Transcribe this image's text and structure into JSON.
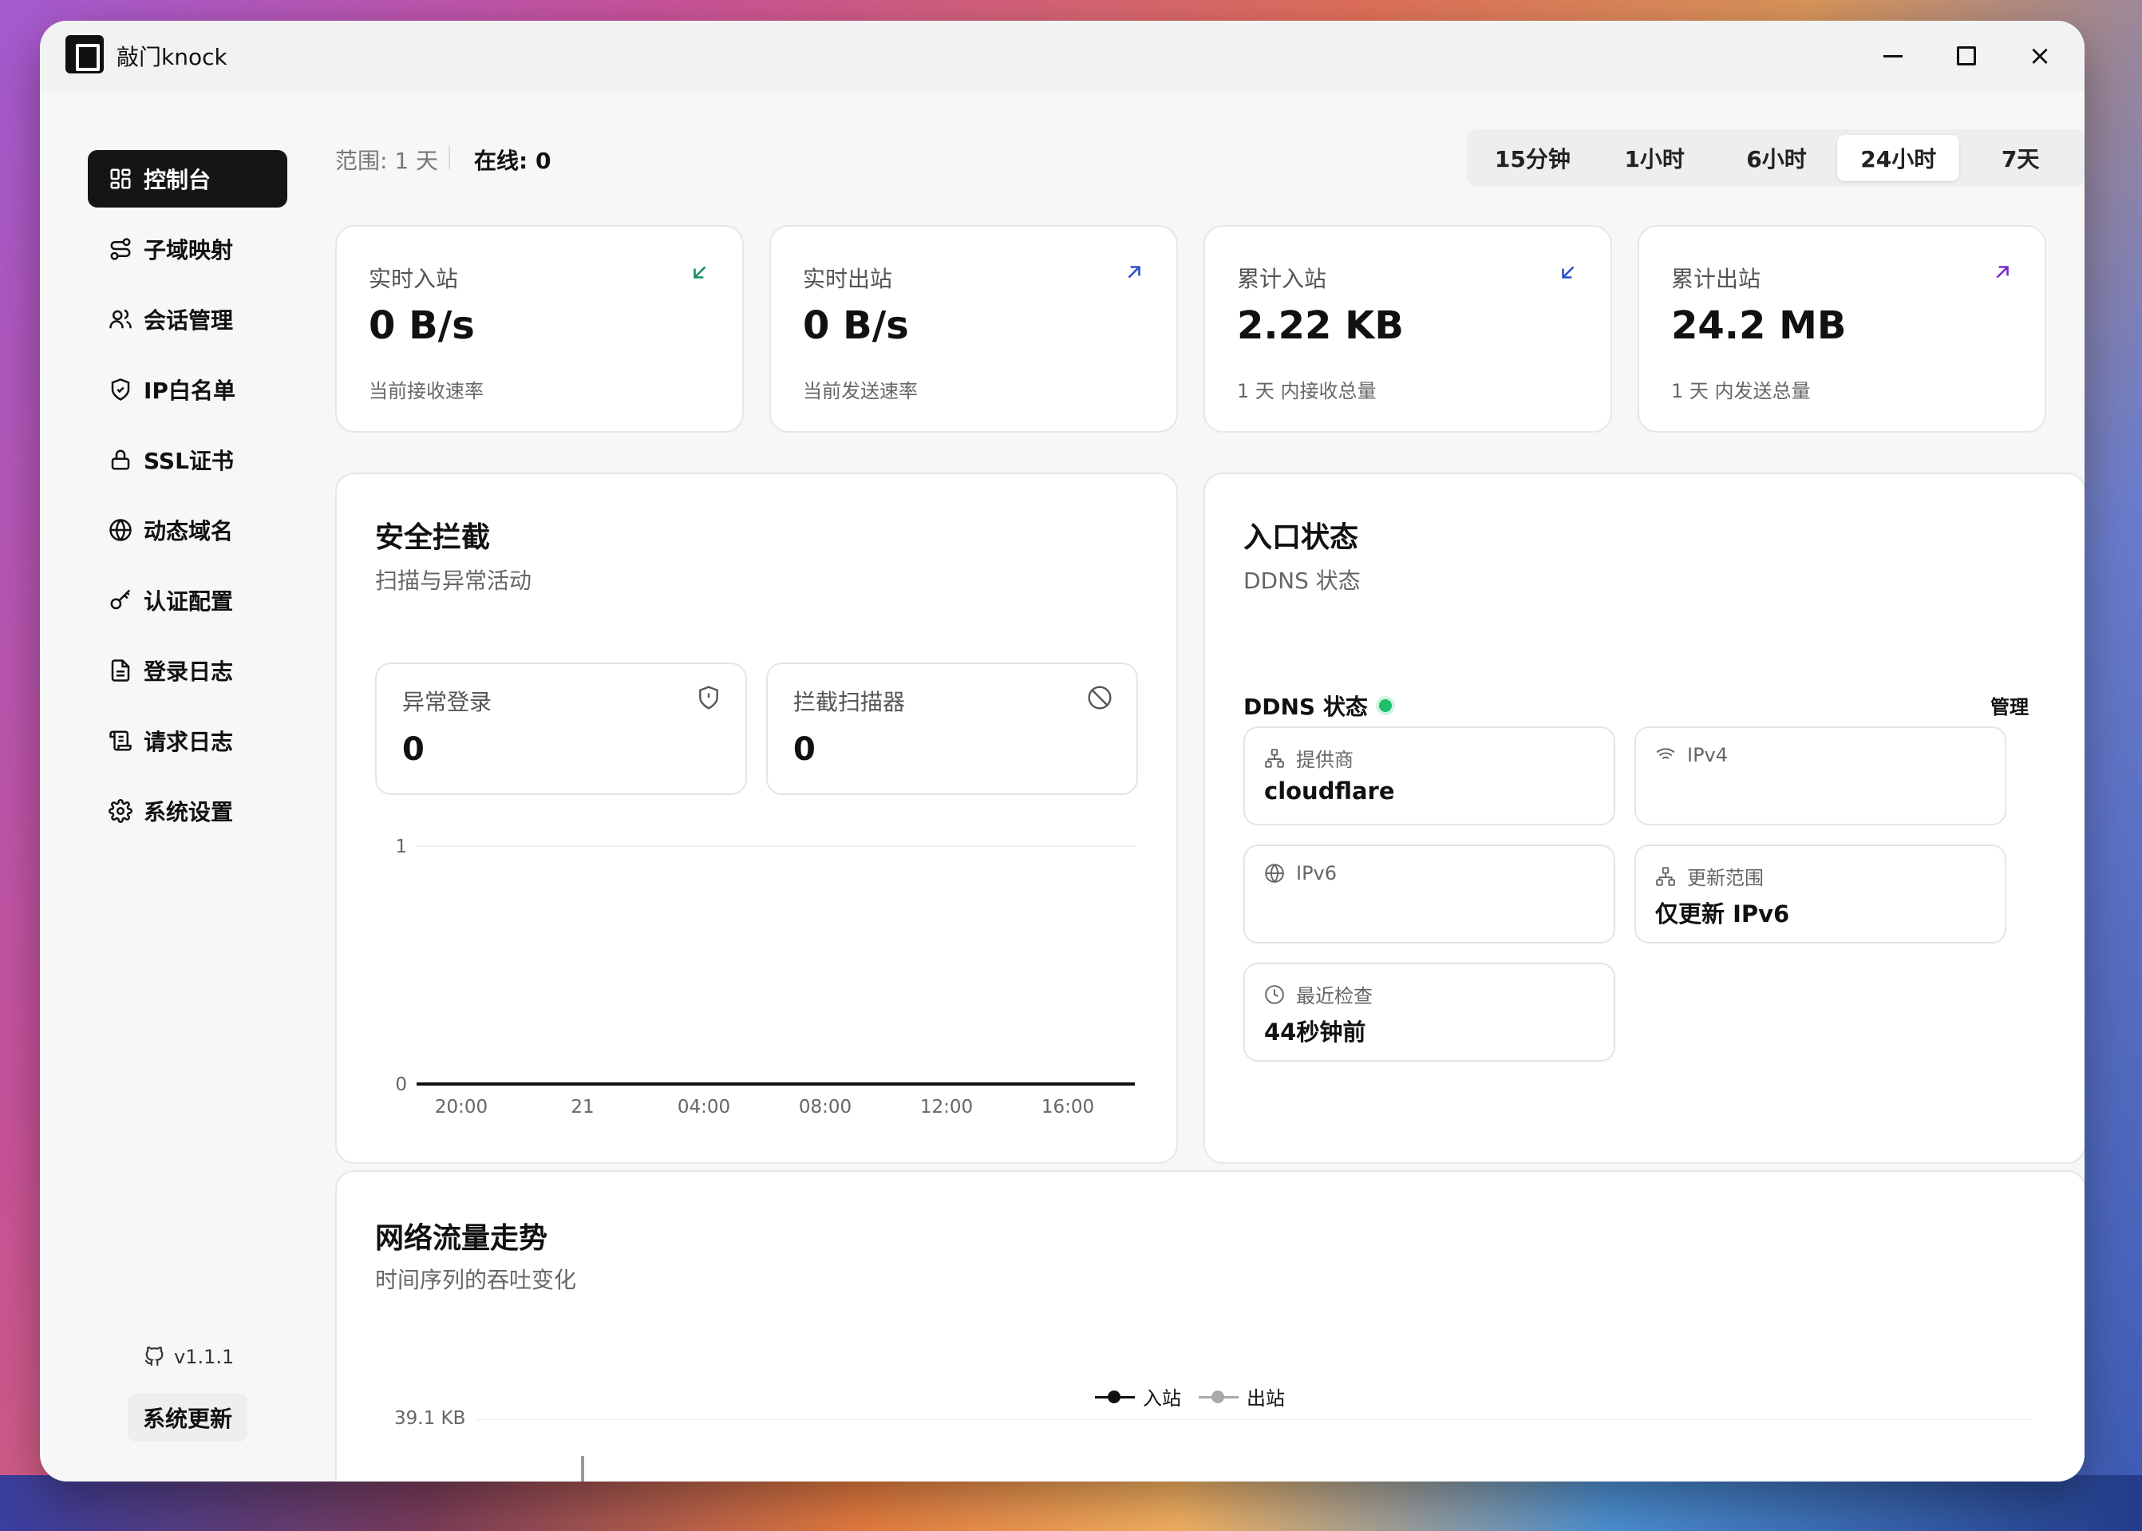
{
  "app": {
    "title": "敲门knock"
  },
  "sidebar": {
    "items": [
      {
        "label": "控制台",
        "icon": "dashboard-icon"
      },
      {
        "label": "子域映射",
        "icon": "route-icon"
      },
      {
        "label": "会话管理",
        "icon": "users-icon"
      },
      {
        "label": "IP白名单",
        "icon": "shield-check-icon"
      },
      {
        "label": "SSL证书",
        "icon": "lock-icon"
      },
      {
        "label": "动态域名",
        "icon": "globe-icon"
      },
      {
        "label": "认证配置",
        "icon": "key-icon"
      },
      {
        "label": "登录日志",
        "icon": "file-text-icon"
      },
      {
        "label": "请求日志",
        "icon": "scroll-icon"
      },
      {
        "label": "系统设置",
        "icon": "gear-icon"
      }
    ],
    "active_index": 0,
    "version": "v1.1.1",
    "update_label": "系统更新"
  },
  "header": {
    "range": "范围: 1 天",
    "online": "在线: 0",
    "time_tabs": [
      "15分钟",
      "1小时",
      "6小时",
      "24小时",
      "7天"
    ],
    "active_tab": 3
  },
  "stats": [
    {
      "label": "实时入站",
      "value": "0 B/s",
      "desc": "当前接收速率",
      "icon": "arrow-down-left-icon"
    },
    {
      "label": "实时出站",
      "value": "0 B/s",
      "desc": "当前发送速率",
      "icon": "arrow-up-right-icon"
    },
    {
      "label": "累计入站",
      "value": "2.22 KB",
      "desc": "1 天 内接收总量",
      "icon": "arrow-down-left-icon"
    },
    {
      "label": "累计出站",
      "value": "24.2 MB",
      "desc": "1 天 内发送总量",
      "icon": "arrow-up-right-icon"
    }
  ],
  "colors": {
    "accent_green": "#1fbf6a",
    "inbound_arrow": "#1a8a6a",
    "outbound_arrow": "#2b50c8"
  },
  "security": {
    "title": "安全拦截",
    "subtitle": "扫描与异常活动",
    "cards": [
      {
        "label": "异常登录",
        "value": "0",
        "icon": "shield-alert-icon"
      },
      {
        "label": "拦截扫描器",
        "value": "0",
        "icon": "ban-icon"
      }
    ]
  },
  "chart_data": [
    {
      "type": "line",
      "x": [
        "20:00",
        "21",
        "04:00",
        "08:00",
        "12:00",
        "16:00"
      ],
      "y_ticks": [
        "0",
        "1"
      ],
      "series": [
        {
          "values": [
            0,
            0,
            0,
            0,
            0,
            0
          ]
        }
      ],
      "ylim": [
        0,
        1
      ]
    },
    {
      "type": "line",
      "title": "网络流量走势",
      "subtitle": "时间序列的吞吐变化",
      "y_ticks": [
        "39.1 KB"
      ],
      "series": [
        {
          "name": "入站"
        },
        {
          "name": "出站"
        }
      ],
      "legend": "top-center"
    }
  ],
  "entry": {
    "title": "入口状态",
    "subtitle": "DDNS 状态",
    "ddns_label": "DDNS 状态",
    "manage_label": "管理",
    "cards": [
      {
        "label": "提供商",
        "value": "cloudflare",
        "icon": "network-icon"
      },
      {
        "label": "IPv4",
        "value": "",
        "icon": "wifi-icon"
      },
      {
        "label": "IPv6",
        "value": "",
        "icon": "globe-icon"
      },
      {
        "label": "更新范围",
        "value": "仅更新 IPv6",
        "icon": "network-icon"
      },
      {
        "label": "最近检查",
        "value": "44秒钟前",
        "icon": "clock-icon"
      }
    ]
  }
}
